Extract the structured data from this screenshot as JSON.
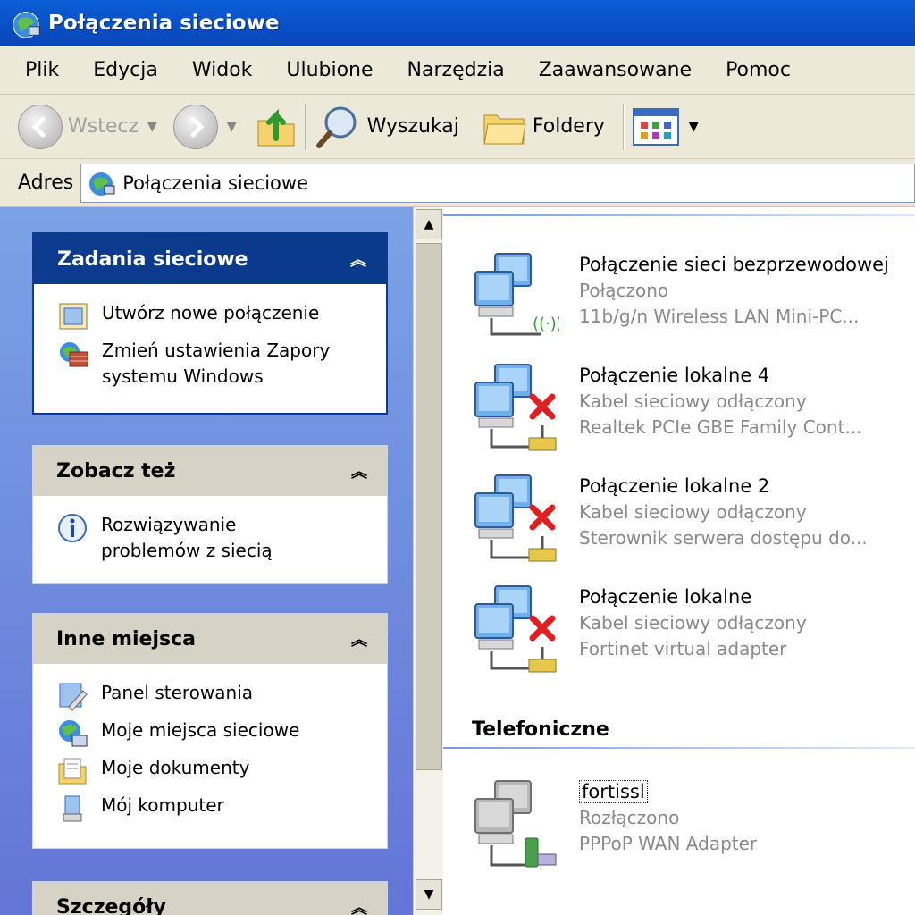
{
  "window": {
    "title": "Połączenia sieciowe",
    "icon": "network-connections-icon"
  },
  "menu": {
    "items": [
      "Plik",
      "Edycja",
      "Widok",
      "Ulubione",
      "Narzędzia",
      "Zaawansowane",
      "Pomoc"
    ]
  },
  "toolbar": {
    "back_label": "Wstecz",
    "search_label": "Wyszukaj",
    "folders_label": "Foldery"
  },
  "address": {
    "label": "Adres",
    "value": "Połączenia sieciowe"
  },
  "tasks": {
    "network_tasks": {
      "title": "Zadania sieciowe",
      "items": [
        "Utwórz nowe połączenie",
        "Zmień ustawienia Zapory systemu Windows"
      ]
    },
    "see_also": {
      "title": "Zobacz też",
      "items": [
        "Rozwiązywanie problemów z siecią"
      ]
    },
    "other_places": {
      "title": "Inne miejsca",
      "items": [
        "Panel sterowania",
        "Moje miejsca sieciowe",
        "Moje dokumenty",
        "Mój komputer"
      ]
    },
    "details": {
      "title": "Szczegóły"
    }
  },
  "connections": [
    {
      "name": "Połączenie sieci bezprzewodowej",
      "status": "Połączono",
      "device": "11b/g/n  Wireless LAN Mini-PC..."
    },
    {
      "name": "Połączenie lokalne 4",
      "status": "Kabel sieciowy odłączony",
      "device": "Realtek PCIe GBE Family Cont..."
    },
    {
      "name": "Połączenie lokalne 2",
      "status": "Kabel sieciowy odłączony",
      "device": "Sterownik serwera dostępu do..."
    },
    {
      "name": "Połączenie lokalne",
      "status": "Kabel sieciowy odłączony",
      "device": "Fortinet virtual adapter"
    }
  ],
  "dialup": {
    "group_title": "Telefoniczne",
    "items": [
      {
        "name": "fortissl",
        "status": "Rozłączono",
        "device": "PPPoP WAN Adapter"
      }
    ]
  },
  "colors": {
    "titlebar": "#0a52c8",
    "taskpane_header": "#0c3b8f",
    "link": "#215dc6"
  }
}
